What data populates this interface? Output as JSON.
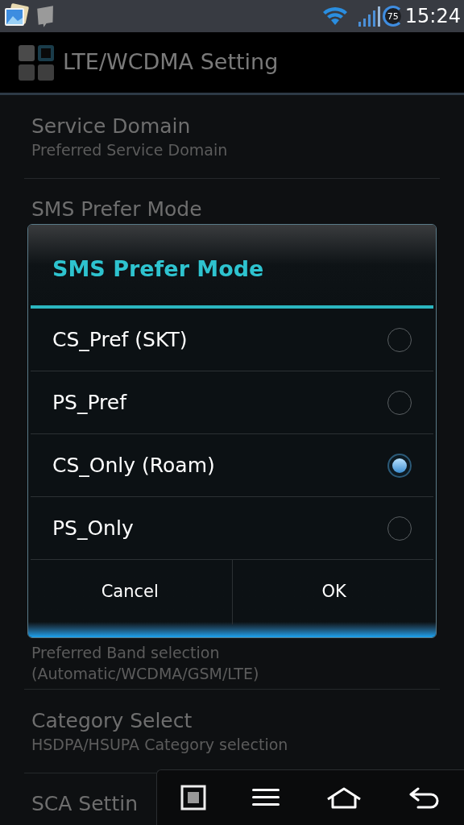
{
  "status_bar": {
    "battery": "75",
    "time": "15:24"
  },
  "action_bar": {
    "title": "LTE/WCDMA Setting"
  },
  "settings": [
    {
      "title": "Service Domain",
      "subtitle": "Preferred Service Domain"
    },
    {
      "title": "SMS Prefer Mode"
    },
    {
      "kind": "hidden"
    },
    {
      "subtitle": "Preferred Band selection (Automatic/WCDMA/GSM/LTE)"
    },
    {
      "title": "Category Select",
      "subtitle": "HSDPA/HSUPA Category selection"
    },
    {
      "title": "SCA Settin"
    }
  ],
  "dialog": {
    "title": "SMS Prefer Mode",
    "options": [
      {
        "label": "CS_Pref (SKT)",
        "selected": false
      },
      {
        "label": "PS_Pref",
        "selected": false
      },
      {
        "label": "CS_Only (Roam)",
        "selected": true
      },
      {
        "label": "PS_Only",
        "selected": false
      }
    ],
    "buttons": [
      "Cancel",
      "OK"
    ]
  }
}
